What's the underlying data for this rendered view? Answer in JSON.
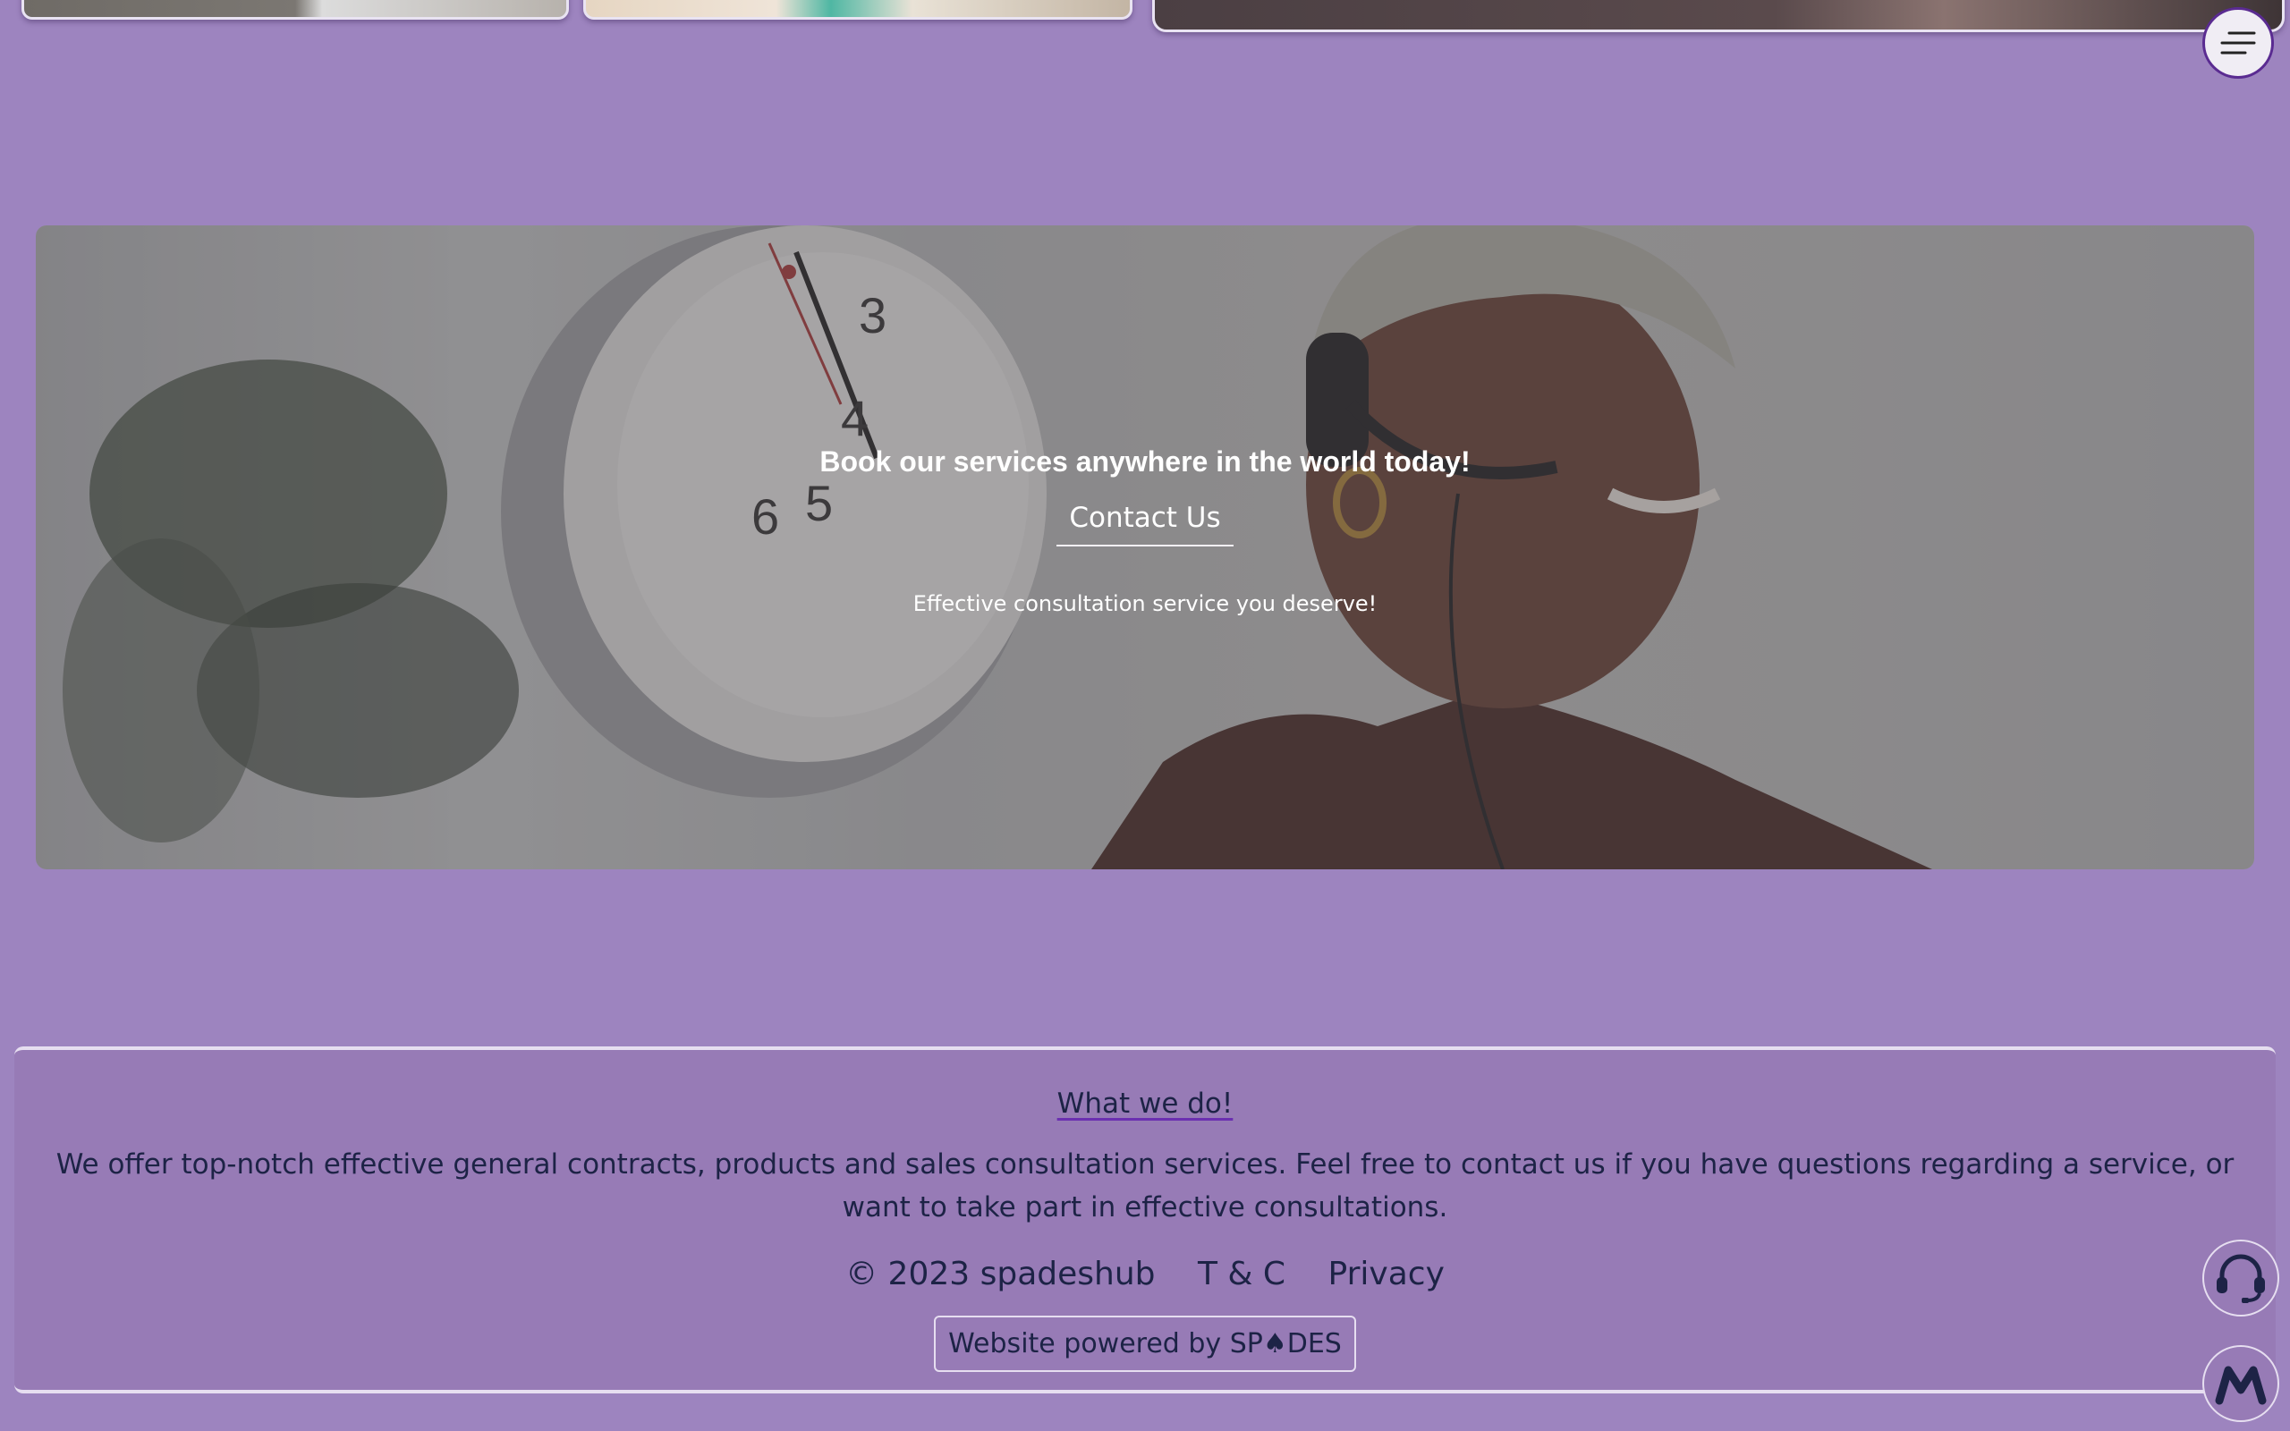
{
  "hero": {
    "title": "Book our services anywhere in the world today!",
    "contact_label": "Contact Us",
    "subtitle": "Effective consultation service you deserve!",
    "clock_numbers": [
      "3",
      "4",
      "5",
      "6"
    ]
  },
  "footer": {
    "heading": "What we do!",
    "description": "We offer top-notch effective general contracts, products and sales consultation services. Feel free to contact us if you have questions regarding a service, or want to take part in effective consultations.",
    "copyright": "© 2023 spadeshub",
    "terms_label": "T & C",
    "privacy_label": "Privacy",
    "powered_by": "Website powered by SP♠DES"
  },
  "icons": {
    "menu": "hamburger-menu-icon",
    "support": "headset-support-icon",
    "m_logo": "m-logo-icon"
  },
  "colors": {
    "background": "#9d84bf",
    "footer_text": "#1d2346",
    "accent": "#5a2b91"
  }
}
